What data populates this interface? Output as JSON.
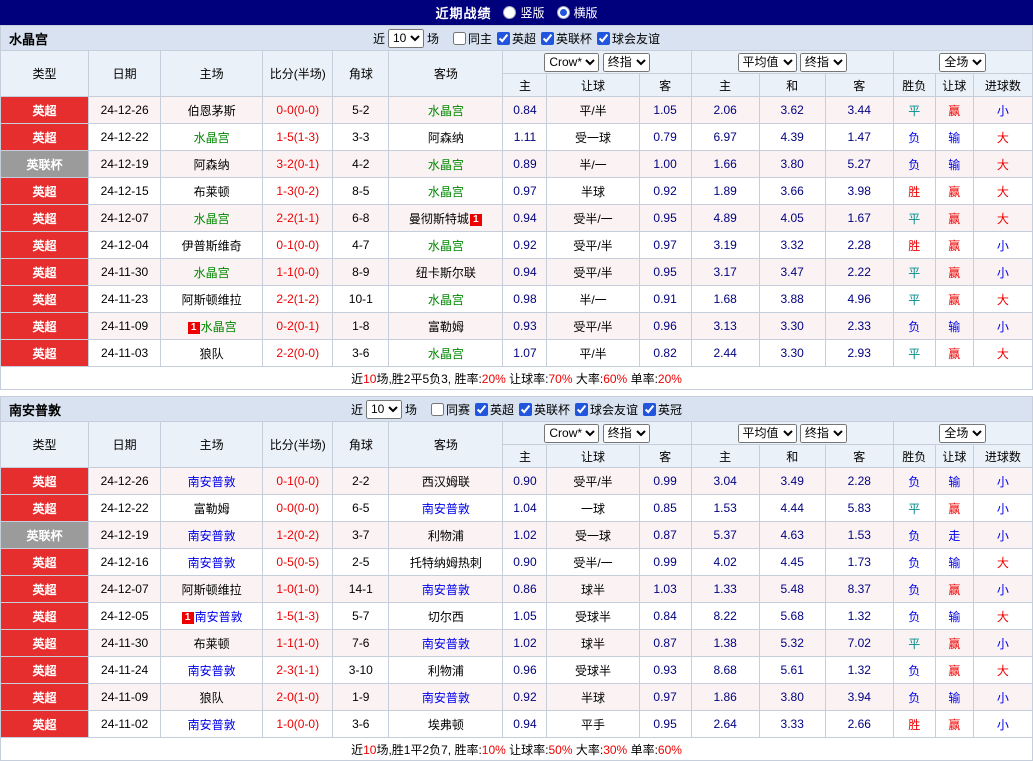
{
  "colors": {
    "topbar_bg": "#00007D",
    "league_red_bg": "#E62E2E",
    "league_gray_bg": "#9B9B9B",
    "score_red": "#EE0000",
    "odds_navy": "#00007F",
    "result_red": "#EE0000",
    "result_blue": "#0000E8",
    "result_teal": "#008B8B",
    "focus_team_colors": [
      "#008800",
      "#0000EE"
    ],
    "team_row_bg": "#D8E2F0",
    "header_bg": "#EBF1F8",
    "row_alt_bg": "#FBF3F3"
  },
  "top_bar": {
    "title": "近期战绩",
    "radios": [
      {
        "label": "竖版",
        "selected": false
      },
      {
        "label": "横版",
        "selected": true
      }
    ]
  },
  "sections": [
    {
      "team": "水晶宫",
      "focus_color": "#008800",
      "filter": {
        "pre": "近",
        "count": "10",
        "post": "场",
        "checkboxes": [
          {
            "label": "同主",
            "checked": false
          },
          {
            "label": "英超",
            "checked": true
          },
          {
            "label": "英联杯",
            "checked": true
          },
          {
            "label": "球会友谊",
            "checked": true
          }
        ]
      },
      "header": {
        "cols": [
          "类型",
          "日期",
          "主场",
          "比分(半场)",
          "角球",
          "客场"
        ],
        "bookmaker": "Crow*",
        "asia_index": "终指",
        "euro_avg": "平均值",
        "euro_index": "终指",
        "scope": "全场",
        "sub": [
          "主",
          "让球",
          "客",
          "主",
          "和",
          "客",
          "胜负",
          "让球",
          "进球数"
        ]
      },
      "rows": [
        {
          "league": [
            "英超",
            "red"
          ],
          "date": "24-12-26",
          "home": {
            "name": "伯恩茅斯"
          },
          "score": "0-0(0-0)",
          "corner": "5-2",
          "away": {
            "name": "水晶宫",
            "focus": true
          },
          "asia": [
            "0.84",
            "平/半",
            "1.05"
          ],
          "euro": [
            "2.06",
            "3.62",
            "3.44"
          ],
          "results": [
            [
              "平",
              "teal"
            ],
            [
              "赢",
              "red"
            ],
            [
              "小",
              "blue"
            ]
          ]
        },
        {
          "league": [
            "英超",
            "red"
          ],
          "date": "24-12-22",
          "home": {
            "name": "水晶宫",
            "focus": true
          },
          "score": "1-5(1-3)",
          "corner": "3-3",
          "away": {
            "name": "阿森纳"
          },
          "asia": [
            "1.11",
            "受一球",
            "0.79"
          ],
          "euro": [
            "6.97",
            "4.39",
            "1.47"
          ],
          "results": [
            [
              "负",
              "blue"
            ],
            [
              "输",
              "blue"
            ],
            [
              "大",
              "red"
            ]
          ]
        },
        {
          "league": [
            "英联杯",
            "gray"
          ],
          "date": "24-12-19",
          "home": {
            "name": "阿森纳"
          },
          "score": "3-2(0-1)",
          "corner": "4-2",
          "away": {
            "name": "水晶宫",
            "focus": true
          },
          "asia": [
            "0.89",
            "半/一",
            "1.00"
          ],
          "euro": [
            "1.66",
            "3.80",
            "5.27"
          ],
          "results": [
            [
              "负",
              "blue"
            ],
            [
              "输",
              "blue"
            ],
            [
              "大",
              "red"
            ]
          ]
        },
        {
          "league": [
            "英超",
            "red"
          ],
          "date": "24-12-15",
          "home": {
            "name": "布莱顿"
          },
          "score": "1-3(0-2)",
          "corner": "8-5",
          "away": {
            "name": "水晶宫",
            "focus": true
          },
          "asia": [
            "0.97",
            "半球",
            "0.92"
          ],
          "euro": [
            "1.89",
            "3.66",
            "3.98"
          ],
          "results": [
            [
              "胜",
              "red"
            ],
            [
              "赢",
              "red"
            ],
            [
              "大",
              "red"
            ]
          ]
        },
        {
          "league": [
            "英超",
            "red"
          ],
          "date": "24-12-07",
          "home": {
            "name": "水晶宫",
            "focus": true
          },
          "score": "2-2(1-1)",
          "corner": "6-8",
          "away": {
            "name": "曼彻斯特城",
            "badge": "1",
            "badge_pos": "after"
          },
          "asia": [
            "0.94",
            "受半/一",
            "0.95"
          ],
          "euro": [
            "4.89",
            "4.05",
            "1.67"
          ],
          "results": [
            [
              "平",
              "teal"
            ],
            [
              "赢",
              "red"
            ],
            [
              "大",
              "red"
            ]
          ]
        },
        {
          "league": [
            "英超",
            "red"
          ],
          "date": "24-12-04",
          "home": {
            "name": "伊普斯维奇"
          },
          "score": "0-1(0-0)",
          "corner": "4-7",
          "away": {
            "name": "水晶宫",
            "focus": true
          },
          "asia": [
            "0.92",
            "受平/半",
            "0.97"
          ],
          "euro": [
            "3.19",
            "3.32",
            "2.28"
          ],
          "results": [
            [
              "胜",
              "red"
            ],
            [
              "赢",
              "red"
            ],
            [
              "小",
              "blue"
            ]
          ]
        },
        {
          "league": [
            "英超",
            "red"
          ],
          "date": "24-11-30",
          "home": {
            "name": "水晶宫",
            "focus": true
          },
          "score": "1-1(0-0)",
          "corner": "8-9",
          "away": {
            "name": "纽卡斯尔联"
          },
          "asia": [
            "0.94",
            "受平/半",
            "0.95"
          ],
          "euro": [
            "3.17",
            "3.47",
            "2.22"
          ],
          "results": [
            [
              "平",
              "teal"
            ],
            [
              "赢",
              "red"
            ],
            [
              "小",
              "blue"
            ]
          ]
        },
        {
          "league": [
            "英超",
            "red"
          ],
          "date": "24-11-23",
          "home": {
            "name": "阿斯顿维拉"
          },
          "score": "2-2(1-2)",
          "corner": "10-1",
          "away": {
            "name": "水晶宫",
            "focus": true
          },
          "asia": [
            "0.98",
            "半/一",
            "0.91"
          ],
          "euro": [
            "1.68",
            "3.88",
            "4.96"
          ],
          "results": [
            [
              "平",
              "teal"
            ],
            [
              "赢",
              "red"
            ],
            [
              "大",
              "red"
            ]
          ]
        },
        {
          "league": [
            "英超",
            "red"
          ],
          "date": "24-11-09",
          "home": {
            "name": "水晶宫",
            "focus": true,
            "badge": "1",
            "badge_pos": "before"
          },
          "score": "0-2(0-1)",
          "corner": "1-8",
          "away": {
            "name": "富勒姆"
          },
          "asia": [
            "0.93",
            "受平/半",
            "0.96"
          ],
          "euro": [
            "3.13",
            "3.30",
            "2.33"
          ],
          "results": [
            [
              "负",
              "blue"
            ],
            [
              "输",
              "blue"
            ],
            [
              "小",
              "blue"
            ]
          ]
        },
        {
          "league": [
            "英超",
            "red"
          ],
          "date": "24-11-03",
          "home": {
            "name": "狼队"
          },
          "score": "2-2(0-0)",
          "corner": "3-6",
          "away": {
            "name": "水晶宫",
            "focus": true
          },
          "asia": [
            "1.07",
            "平/半",
            "0.82"
          ],
          "euro": [
            "2.44",
            "3.30",
            "2.93"
          ],
          "results": [
            [
              "平",
              "teal"
            ],
            [
              "赢",
              "red"
            ],
            [
              "大",
              "red"
            ]
          ]
        }
      ],
      "summary": [
        {
          "t": "近",
          "r": false
        },
        {
          "t": "10",
          "r": true
        },
        {
          "t": "场,胜2平5负3, 胜率:",
          "r": false
        },
        {
          "t": "20%",
          "r": true
        },
        {
          "t": " 让球率:",
          "r": false
        },
        {
          "t": "70%",
          "r": true
        },
        {
          "t": " 大率:",
          "r": false
        },
        {
          "t": "60%",
          "r": true
        },
        {
          "t": " 单率:",
          "r": false
        },
        {
          "t": "20%",
          "r": true
        }
      ]
    },
    {
      "team": "南安普敦",
      "focus_color": "#0000EE",
      "filter": {
        "pre": "近",
        "count": "10",
        "post": "场",
        "checkboxes": [
          {
            "label": "同赛",
            "checked": false
          },
          {
            "label": "英超",
            "checked": true
          },
          {
            "label": "英联杯",
            "checked": true
          },
          {
            "label": "球会友谊",
            "checked": true
          },
          {
            "label": "英冠",
            "checked": true
          }
        ]
      },
      "header": {
        "cols": [
          "类型",
          "日期",
          "主场",
          "比分(半场)",
          "角球",
          "客场"
        ],
        "bookmaker": "Crow*",
        "asia_index": "终指",
        "euro_avg": "平均值",
        "euro_index": "终指",
        "scope": "全场",
        "sub": [
          "主",
          "让球",
          "客",
          "主",
          "和",
          "客",
          "胜负",
          "让球",
          "进球数"
        ]
      },
      "rows": [
        {
          "league": [
            "英超",
            "red"
          ],
          "date": "24-12-26",
          "home": {
            "name": "南安普敦",
            "focus": true
          },
          "score": "0-1(0-0)",
          "corner": "2-2",
          "away": {
            "name": "西汉姆联"
          },
          "asia": [
            "0.90",
            "受平/半",
            "0.99"
          ],
          "euro": [
            "3.04",
            "3.49",
            "2.28"
          ],
          "results": [
            [
              "负",
              "blue"
            ],
            [
              "输",
              "blue"
            ],
            [
              "小",
              "blue"
            ]
          ]
        },
        {
          "league": [
            "英超",
            "red"
          ],
          "date": "24-12-22",
          "home": {
            "name": "富勒姆"
          },
          "score": "0-0(0-0)",
          "corner": "6-5",
          "away": {
            "name": "南安普敦",
            "focus": true
          },
          "asia": [
            "1.04",
            "一球",
            "0.85"
          ],
          "euro": [
            "1.53",
            "4.44",
            "5.83"
          ],
          "results": [
            [
              "平",
              "teal"
            ],
            [
              "赢",
              "red"
            ],
            [
              "小",
              "blue"
            ]
          ]
        },
        {
          "league": [
            "英联杯",
            "gray"
          ],
          "date": "24-12-19",
          "home": {
            "name": "南安普敦",
            "focus": true
          },
          "score": "1-2(0-2)",
          "corner": "3-7",
          "away": {
            "name": "利物浦"
          },
          "asia": [
            "1.02",
            "受一球",
            "0.87"
          ],
          "euro": [
            "5.37",
            "4.63",
            "1.53"
          ],
          "results": [
            [
              "负",
              "blue"
            ],
            [
              "走",
              "blue"
            ],
            [
              "小",
              "blue"
            ]
          ]
        },
        {
          "league": [
            "英超",
            "red"
          ],
          "date": "24-12-16",
          "home": {
            "name": "南安普敦",
            "focus": true
          },
          "score": "0-5(0-5)",
          "corner": "2-5",
          "away": {
            "name": "托特纳姆热刺"
          },
          "asia": [
            "0.90",
            "受半/一",
            "0.99"
          ],
          "euro": [
            "4.02",
            "4.45",
            "1.73"
          ],
          "results": [
            [
              "负",
              "blue"
            ],
            [
              "输",
              "blue"
            ],
            [
              "大",
              "red"
            ]
          ]
        },
        {
          "league": [
            "英超",
            "red"
          ],
          "date": "24-12-07",
          "home": {
            "name": "阿斯顿维拉"
          },
          "score": "1-0(1-0)",
          "corner": "14-1",
          "away": {
            "name": "南安普敦",
            "focus": true
          },
          "asia": [
            "0.86",
            "球半",
            "1.03"
          ],
          "euro": [
            "1.33",
            "5.48",
            "8.37"
          ],
          "results": [
            [
              "负",
              "blue"
            ],
            [
              "赢",
              "red"
            ],
            [
              "小",
              "blue"
            ]
          ]
        },
        {
          "league": [
            "英超",
            "red"
          ],
          "date": "24-12-05",
          "home": {
            "name": "南安普敦",
            "focus": true,
            "badge": "1",
            "badge_pos": "before"
          },
          "score": "1-5(1-3)",
          "corner": "5-7",
          "away": {
            "name": "切尔西"
          },
          "asia": [
            "1.05",
            "受球半",
            "0.84"
          ],
          "euro": [
            "8.22",
            "5.68",
            "1.32"
          ],
          "results": [
            [
              "负",
              "blue"
            ],
            [
              "输",
              "blue"
            ],
            [
              "大",
              "red"
            ]
          ]
        },
        {
          "league": [
            "英超",
            "red"
          ],
          "date": "24-11-30",
          "home": {
            "name": "布莱顿"
          },
          "score": "1-1(1-0)",
          "corner": "7-6",
          "away": {
            "name": "南安普敦",
            "focus": true
          },
          "asia": [
            "1.02",
            "球半",
            "0.87"
          ],
          "euro": [
            "1.38",
            "5.32",
            "7.02"
          ],
          "results": [
            [
              "平",
              "teal"
            ],
            [
              "赢",
              "red"
            ],
            [
              "小",
              "blue"
            ]
          ]
        },
        {
          "league": [
            "英超",
            "red"
          ],
          "date": "24-11-24",
          "home": {
            "name": "南安普敦",
            "focus": true
          },
          "score": "2-3(1-1)",
          "corner": "3-10",
          "away": {
            "name": "利物浦"
          },
          "asia": [
            "0.96",
            "受球半",
            "0.93"
          ],
          "euro": [
            "8.68",
            "5.61",
            "1.32"
          ],
          "results": [
            [
              "负",
              "blue"
            ],
            [
              "赢",
              "red"
            ],
            [
              "大",
              "red"
            ]
          ]
        },
        {
          "league": [
            "英超",
            "red"
          ],
          "date": "24-11-09",
          "home": {
            "name": "狼队"
          },
          "score": "2-0(1-0)",
          "corner": "1-9",
          "away": {
            "name": "南安普敦",
            "focus": true
          },
          "asia": [
            "0.92",
            "半球",
            "0.97"
          ],
          "euro": [
            "1.86",
            "3.80",
            "3.94"
          ],
          "results": [
            [
              "负",
              "blue"
            ],
            [
              "输",
              "blue"
            ],
            [
              "小",
              "blue"
            ]
          ]
        },
        {
          "league": [
            "英超",
            "red"
          ],
          "date": "24-11-02",
          "home": {
            "name": "南安普敦",
            "focus": true
          },
          "score": "1-0(0-0)",
          "corner": "3-6",
          "away": {
            "name": "埃弗顿"
          },
          "asia": [
            "0.94",
            "平手",
            "0.95"
          ],
          "euro": [
            "2.64",
            "3.33",
            "2.66"
          ],
          "results": [
            [
              "胜",
              "red"
            ],
            [
              "赢",
              "red"
            ],
            [
              "小",
              "blue"
            ]
          ]
        }
      ],
      "summary": [
        {
          "t": "近",
          "r": false
        },
        {
          "t": "10",
          "r": true
        },
        {
          "t": "场,胜1平2负7, 胜率:",
          "r": false
        },
        {
          "t": "10%",
          "r": true
        },
        {
          "t": " 让球率:",
          "r": false
        },
        {
          "t": "50%",
          "r": true
        },
        {
          "t": " 大率:",
          "r": false
        },
        {
          "t": "30%",
          "r": true
        },
        {
          "t": " 单率:",
          "r": false
        },
        {
          "t": "60%",
          "r": true
        }
      ]
    }
  ]
}
